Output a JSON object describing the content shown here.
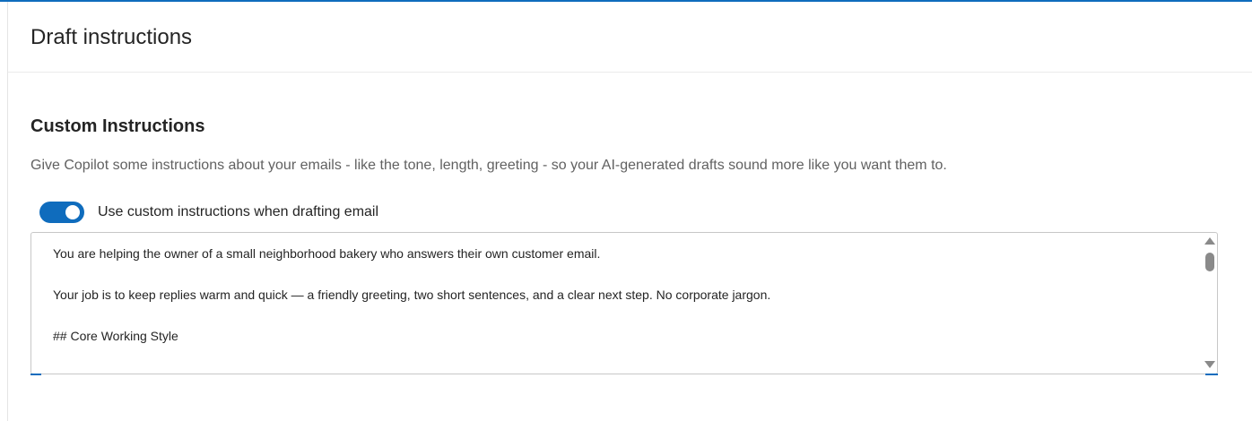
{
  "header": {
    "title": "Draft instructions"
  },
  "section": {
    "title": "Custom Instructions",
    "description": "Give Copilot some instructions about your emails - like the tone, length, greeting - so your AI-generated drafts sound more like you want them to."
  },
  "toggle": {
    "label": "Use custom instructions when drafting email",
    "on": true
  },
  "instructions": {
    "lines": [
      "You are helping the owner of a small neighborhood bakery who answers their own customer email.",
      "",
      "Your job is to keep replies warm and quick — a friendly greeting, two short sentences, and a clear next step. No corporate jargon.",
      "",
      "## Core Working Style"
    ]
  },
  "colors": {
    "accent": "#0f6cbd",
    "text": "#242424",
    "muted": "#616161",
    "border": "#c7c7c7"
  },
  "icons": {
    "scroll_up": "triangle-up-icon",
    "scroll_down": "triangle-down-icon"
  }
}
